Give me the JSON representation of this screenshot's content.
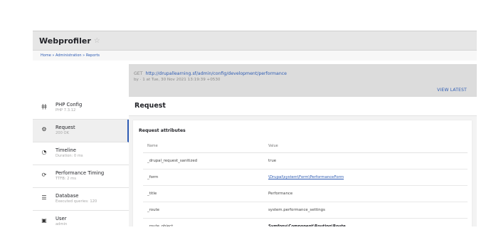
{
  "header": {
    "site_title": "Webprofiler",
    "favorite_icon": "star-icon"
  },
  "breadcrumb": "Home » Administration » Reports",
  "summary": {
    "method": "GET",
    "url": "http://drupallearning.sf/admin/config/development/performance",
    "meta": "by · 1 at Tue, 30 Nov 2021 13:19:39 +0530",
    "view_latest": "VIEW LATEST"
  },
  "sidebar": {
    "items": [
      {
        "icon": "php-icon",
        "name": "PHP Config",
        "sub": "PHP 7.3.12"
      },
      {
        "icon": "gears-icon",
        "name": "Request",
        "sub": "200 OK",
        "active": true
      },
      {
        "icon": "stopwatch-icon",
        "name": "Timeline",
        "sub": "Duration: 0 ms"
      },
      {
        "icon": "performance-icon",
        "name": "Performance Timing",
        "sub": "TTFB: 2 ms"
      },
      {
        "icon": "database-icon",
        "name": "Database",
        "sub": "Executed queries: 120"
      },
      {
        "icon": "user-icon",
        "name": "User",
        "sub": "admin"
      }
    ]
  },
  "content": {
    "title": "Request",
    "card_title": "Request attributes",
    "columns": [
      "Name",
      "Value"
    ],
    "rows": [
      {
        "name": "_drupal_request_sanitized",
        "value": "true",
        "style": ""
      },
      {
        "name": "_form",
        "value": "\\Drupal\\system\\Form\\PerformanceForm",
        "style": "link"
      },
      {
        "name": "_title",
        "value": "Performance",
        "style": ""
      },
      {
        "name": "_route",
        "value": "system.performance_settings",
        "style": ""
      },
      {
        "name": "_route_object",
        "value": "Symfony\\Component\\Routing\\Route",
        "style": "bold"
      }
    ]
  }
}
